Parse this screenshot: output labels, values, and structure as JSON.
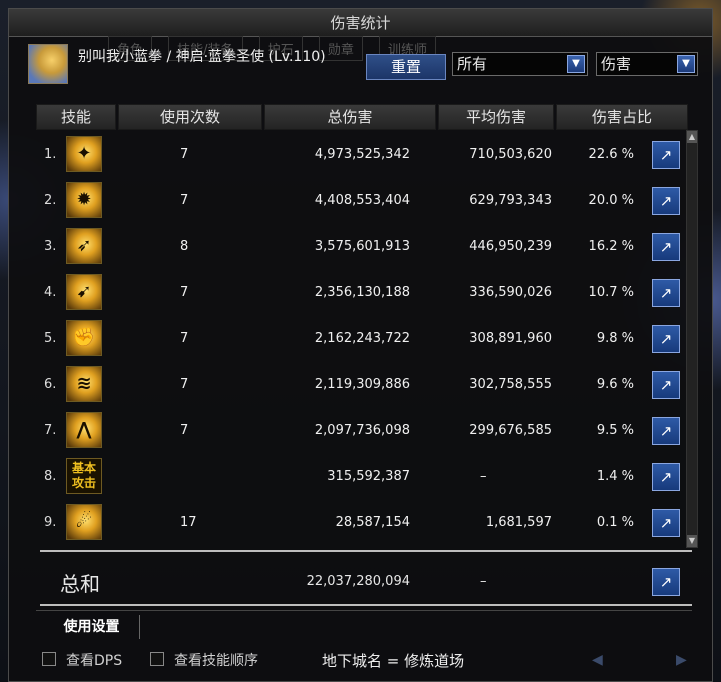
{
  "window": {
    "title": "伤害统计"
  },
  "background_tabs": [
    "角色",
    "技能/装备",
    "护石",
    "勋章",
    "训练师"
  ],
  "character": {
    "name": "别叫我小蓝拳 / 神启·蓝拳圣使 (Lv.110)"
  },
  "controls": {
    "reset_label": "重置",
    "filter_value": "所有",
    "metric_value": "伤害",
    "arrow_glyph": "▼"
  },
  "table": {
    "headers": {
      "skill": "技能",
      "uses": "使用次数",
      "total": "总伤害",
      "avg": "平均伤害",
      "pct": "伤害占比"
    },
    "pct_suffix": "%",
    "rows": [
      {
        "rank": "1.",
        "uses": "7",
        "total": "4,973,525,342",
        "avg": "710,503,620",
        "pct": "22.6"
      },
      {
        "rank": "2.",
        "uses": "7",
        "total": "4,408,553,404",
        "avg": "629,793,343",
        "pct": "20.0"
      },
      {
        "rank": "3.",
        "uses": "8",
        "total": "3,575,601,913",
        "avg": "446,950,239",
        "pct": "16.2"
      },
      {
        "rank": "4.",
        "uses": "7",
        "total": "2,356,130,188",
        "avg": "336,590,026",
        "pct": "10.7"
      },
      {
        "rank": "5.",
        "uses": "7",
        "total": "2,162,243,722",
        "avg": "308,891,960",
        "pct": "9.8"
      },
      {
        "rank": "6.",
        "uses": "7",
        "total": "2,119,309,886",
        "avg": "302,758,555",
        "pct": "9.6"
      },
      {
        "rank": "7.",
        "uses": "7",
        "total": "2,097,736,098",
        "avg": "299,676,585",
        "pct": "9.5"
      },
      {
        "rank": "8.",
        "uses": "",
        "total": "315,592,387",
        "avg": "–",
        "pct": "1.4",
        "icon_text": "基本攻击"
      },
      {
        "rank": "9.",
        "uses": "17",
        "total": "28,587,154",
        "avg": "1,681,597",
        "pct": "0.1"
      }
    ]
  },
  "totals": {
    "label": "总和",
    "total": "22,037,280,094",
    "avg": "–"
  },
  "settings": {
    "tab_label": "使用设置"
  },
  "footer": {
    "show_dps": "查看DPS",
    "show_skill_order": "查看技能顺序",
    "dungeon": "地下城名 = 修炼道场"
  },
  "icons": {
    "share": "share-icon",
    "scroll_up": "▲",
    "scroll_down": "▼",
    "nav_prev": "◀",
    "nav_next": "▶"
  }
}
